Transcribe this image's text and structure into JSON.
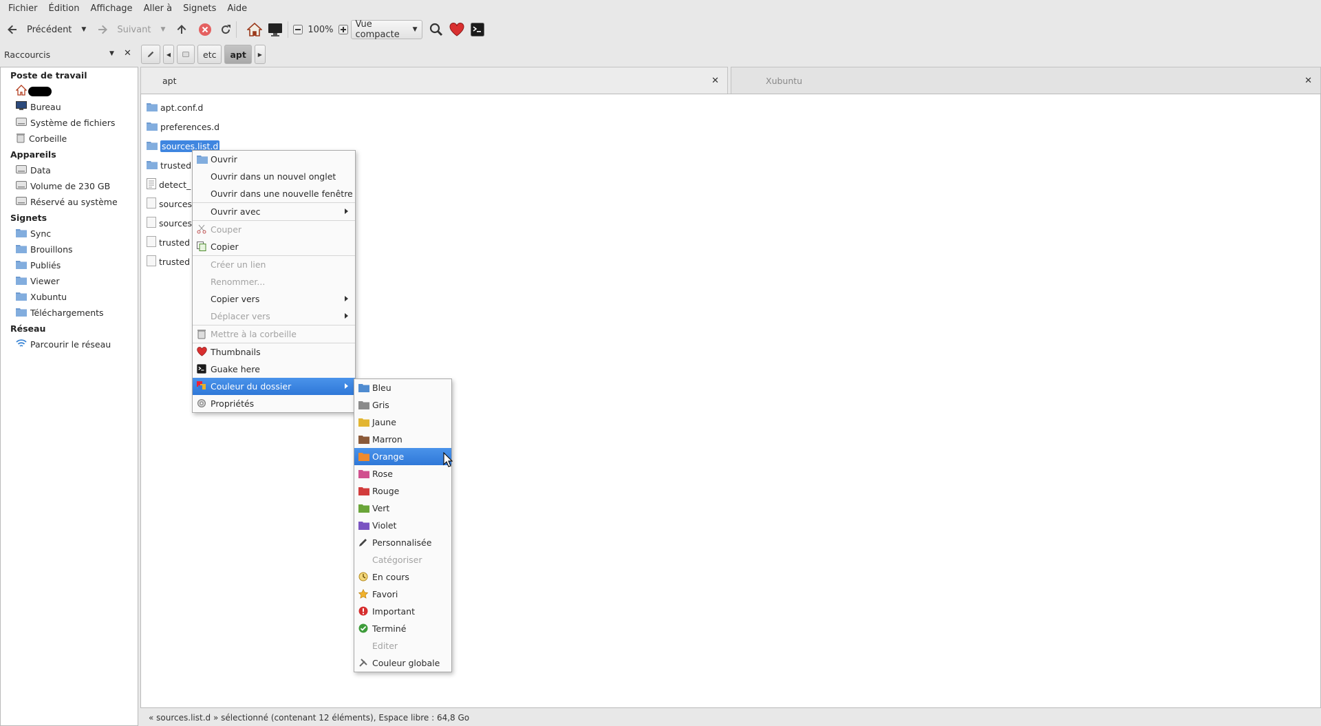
{
  "menubar": [
    "Fichier",
    "Édition",
    "Affichage",
    "Aller à",
    "Signets",
    "Aide"
  ],
  "toolbar": {
    "back": "Précédent",
    "forward": "Suivant",
    "zoom": "100%",
    "view_mode": "Vue compacte"
  },
  "sidebar": {
    "title": "Raccourcis",
    "sections": [
      {
        "label": "Poste de travail",
        "items": [
          {
            "label": "",
            "icon": "home-icon"
          },
          {
            "label": "Bureau",
            "icon": "desktop-icon"
          },
          {
            "label": "Système de fichiers",
            "icon": "drive-icon"
          },
          {
            "label": "Corbeille",
            "icon": "trash-icon"
          }
        ]
      },
      {
        "label": "Appareils",
        "items": [
          {
            "label": "Data",
            "icon": "drive-icon"
          },
          {
            "label": "Volume de 230 GB",
            "icon": "drive-icon"
          },
          {
            "label": "Réservé au système",
            "icon": "drive-icon"
          }
        ]
      },
      {
        "label": "Signets",
        "items": [
          {
            "label": "Sync",
            "icon": "folder-icon"
          },
          {
            "label": "Brouillons",
            "icon": "folder-icon"
          },
          {
            "label": "Publiés",
            "icon": "folder-icon"
          },
          {
            "label": "Viewer",
            "icon": "folder-icon"
          },
          {
            "label": "Xubuntu",
            "icon": "folder-icon"
          },
          {
            "label": "Téléchargements",
            "icon": "folder-icon"
          }
        ]
      },
      {
        "label": "Réseau",
        "items": [
          {
            "label": "Parcourir le réseau",
            "icon": "network-icon"
          }
        ]
      }
    ]
  },
  "pathbar": [
    "etc",
    "apt"
  ],
  "tabs": [
    {
      "label": "apt",
      "active": true
    },
    {
      "label": "Xubuntu",
      "active": false
    }
  ],
  "files": [
    {
      "name": "apt.conf.d",
      "type": "folder"
    },
    {
      "name": "preferences.d",
      "type": "folder"
    },
    {
      "name": "sources.list.d",
      "type": "folder",
      "selected": true
    },
    {
      "name": "trusted",
      "type": "folder"
    },
    {
      "name": "detect_",
      "type": "text"
    },
    {
      "name": "sources",
      "type": "file"
    },
    {
      "name": "sources",
      "type": "file"
    },
    {
      "name": "trusted",
      "type": "file"
    },
    {
      "name": "trusted",
      "type": "file"
    }
  ],
  "context_menu": [
    {
      "label": "Ouvrir",
      "icon": "folder-icon"
    },
    {
      "label": "Ouvrir dans un nouvel onglet"
    },
    {
      "label": "Ouvrir dans une nouvelle fenêtre",
      "sep_after": true
    },
    {
      "label": "Ouvrir avec",
      "submenu": true,
      "sep_after": true
    },
    {
      "label": "Couper",
      "icon": "scissors-icon",
      "disabled": true
    },
    {
      "label": "Copier",
      "icon": "copy-icon",
      "sep_after": true
    },
    {
      "label": "Créer un lien",
      "disabled": true
    },
    {
      "label": "Renommer...",
      "disabled": true
    },
    {
      "label": "Copier vers",
      "submenu": true
    },
    {
      "label": "Déplacer vers",
      "submenu": true,
      "disabled": true,
      "sep_after": true
    },
    {
      "label": "Mettre à la corbeille",
      "icon": "trash-icon",
      "disabled": true,
      "sep_after": true
    },
    {
      "label": "Thumbnails",
      "icon": "heart-icon"
    },
    {
      "label": "Guake here",
      "icon": "terminal-icon"
    },
    {
      "label": "Couleur du dossier",
      "icon": "palette-icon",
      "submenu": true,
      "highlighted": true
    },
    {
      "label": "Propriétés",
      "icon": "gear-icon"
    }
  ],
  "color_submenu": [
    {
      "label": "Bleu",
      "color": "#4f8bd0"
    },
    {
      "label": "Gris",
      "color": "#8a8a8a"
    },
    {
      "label": "Jaune",
      "color": "#e2b531"
    },
    {
      "label": "Marron",
      "color": "#8b5a3a"
    },
    {
      "label": "Orange",
      "color": "#ee8a2c",
      "highlighted": true
    },
    {
      "label": "Rose",
      "color": "#d0508e"
    },
    {
      "label": "Rouge",
      "color": "#d23c3c"
    },
    {
      "label": "Vert",
      "color": "#6aa53a"
    },
    {
      "label": "Violet",
      "color": "#7a55c2"
    },
    {
      "label": "Personnalisée",
      "icon": "pencil-icon"
    },
    {
      "label": "Catégoriser",
      "disabled": true
    },
    {
      "label": "En cours",
      "icon": "progress-icon"
    },
    {
      "label": "Favori",
      "icon": "star-icon"
    },
    {
      "label": "Important",
      "icon": "important-icon"
    },
    {
      "label": "Terminé",
      "icon": "check-icon"
    },
    {
      "label": "Editer",
      "disabled": true
    },
    {
      "label": "Couleur globale",
      "icon": "tools-icon"
    }
  ],
  "status": "« sources.list.d » sélectionné (contenant 12 éléments), Espace libre : 64,8 Go"
}
